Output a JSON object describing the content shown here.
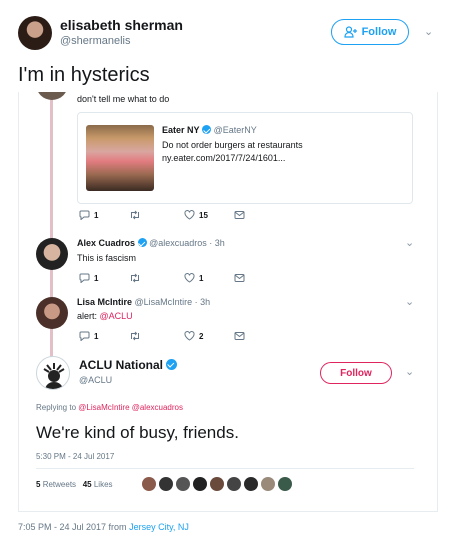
{
  "outer": {
    "name": "elisabeth sherman",
    "handle": "@shermanelis",
    "follow_label": "Follow",
    "text": "I'm in hysterics",
    "timestamp": "7:05 PM - 24 Jul 2017 from",
    "location": "Jersey City, NJ"
  },
  "thread": {
    "top_text": "don't tell me what to do",
    "quote": {
      "author": "Eater NY",
      "handle": "@EaterNY",
      "text": "Do not order burgers at restaurants",
      "link": "ny.eater.com/2017/7/24/1601..."
    },
    "top_actions": {
      "replies": "1",
      "likes": "15"
    },
    "replies": [
      {
        "name": "Alex Cuadros",
        "handle": "@alexcuadros · 3h",
        "text": "This is fascism",
        "replies": "1",
        "likes": "1"
      },
      {
        "name": "Lisa McIntire",
        "handle": "@LisaMcIntire · 3h",
        "text_prefix": "alert: ",
        "mention": "@ACLU",
        "replies": "1",
        "likes": "2"
      }
    ]
  },
  "aclu": {
    "name": "ACLU National",
    "handle": "@ACLU",
    "follow_label": "Follow",
    "replying_prefix": "Replying to",
    "replying_to": "@LisaMcIntire @alexcuadros",
    "text": "We're kind of busy, friends.",
    "timestamp": "5:30 PM - 24 Jul 2017",
    "retweets_count": "5",
    "retweets_label": "Retweets",
    "likes_count": "45",
    "likes_label": "Likes"
  },
  "colors": {
    "brand_blue": "#1da1f2",
    "aclu_red": "#e0245e",
    "thread_line": "#e3bfc7"
  },
  "icons": [
    "follow-user-icon",
    "chevron-down-icon",
    "reply-icon",
    "retweet-icon",
    "like-icon",
    "message-icon",
    "verified-icon"
  ]
}
